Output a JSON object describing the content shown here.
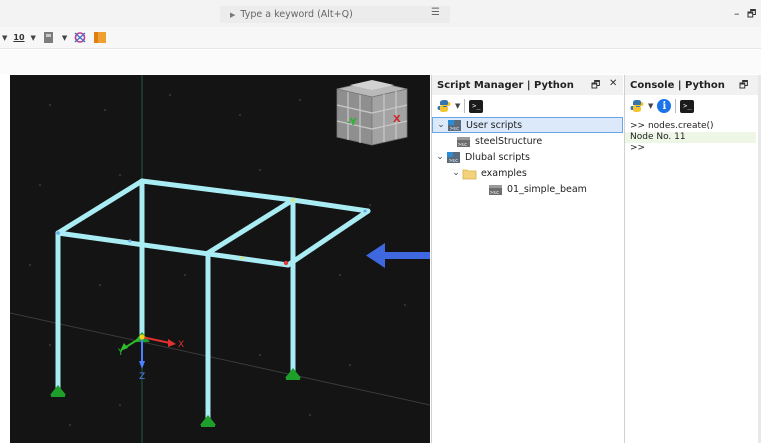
{
  "header": {
    "search_placeholder": "Type a keyword (Alt+Q)",
    "minimize": "–",
    "restore": "🗗"
  },
  "toolbar": {
    "number_label": "10"
  },
  "viewport": {
    "axis_x": "X",
    "axis_y": "Y",
    "axis_z": "Z",
    "cube_front": "-Y",
    "cube_side": "X",
    "colors": {
      "background": "#141414",
      "members": "#a9ecf3",
      "supports": "#1e9e2a",
      "arrow": "#3f68e0"
    }
  },
  "script_manager": {
    "title": "Script Manager | Python",
    "tree": [
      {
        "label": "User scripts",
        "level": 0,
        "expanded": true,
        "icon": "script-folder-icon",
        "selected": true
      },
      {
        "label": "steelStructure",
        "level": 1,
        "icon": "python-script-icon"
      },
      {
        "label": "Dlubal scripts",
        "level": 0,
        "expanded": true,
        "icon": "script-folder-icon"
      },
      {
        "label": "examples",
        "level": 1,
        "expanded": true,
        "icon": "folder-icon"
      },
      {
        "label": "01_simple_beam",
        "level": 2,
        "icon": "python-script-icon"
      }
    ]
  },
  "console": {
    "title": "Console | Python",
    "lines": [
      {
        "text": ">> nodes.create()",
        "type": "input"
      },
      {
        "text": "Node No. 11",
        "type": "output"
      },
      {
        "text": ">>",
        "type": "input"
      }
    ]
  }
}
